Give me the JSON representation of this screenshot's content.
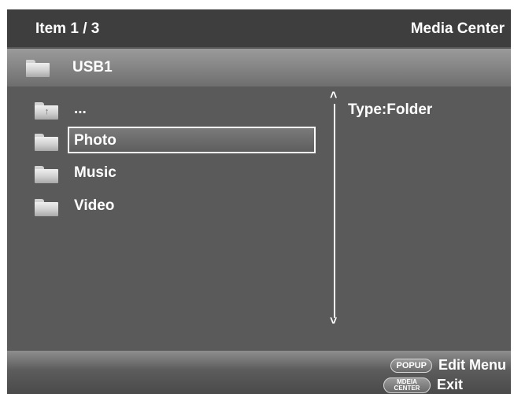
{
  "header": {
    "item_counter": "Item 1 / 3",
    "app_title": "Media Center"
  },
  "path": {
    "label": "USB1"
  },
  "list": {
    "items": [
      {
        "label": "...",
        "icon": "folder-up-icon"
      },
      {
        "label": "Photo",
        "icon": "folder-icon",
        "selected": true
      },
      {
        "label": "Music",
        "icon": "folder-icon"
      },
      {
        "label": "Video",
        "icon": "folder-icon"
      }
    ]
  },
  "info": {
    "type_text": "Type:Folder"
  },
  "scrollbar": {
    "up_glyph": "˄",
    "down_glyph": "˅"
  },
  "footer": {
    "hints": [
      {
        "button": "POPUP",
        "action": "Edit Menu"
      },
      {
        "button_line1": "MDEIA",
        "button_line2": "CENTER",
        "action": "Exit"
      }
    ]
  },
  "colors": {
    "screen_bg": "#5a5a5a",
    "header_bg": "#3e3e3e",
    "text": "#ffffff"
  }
}
